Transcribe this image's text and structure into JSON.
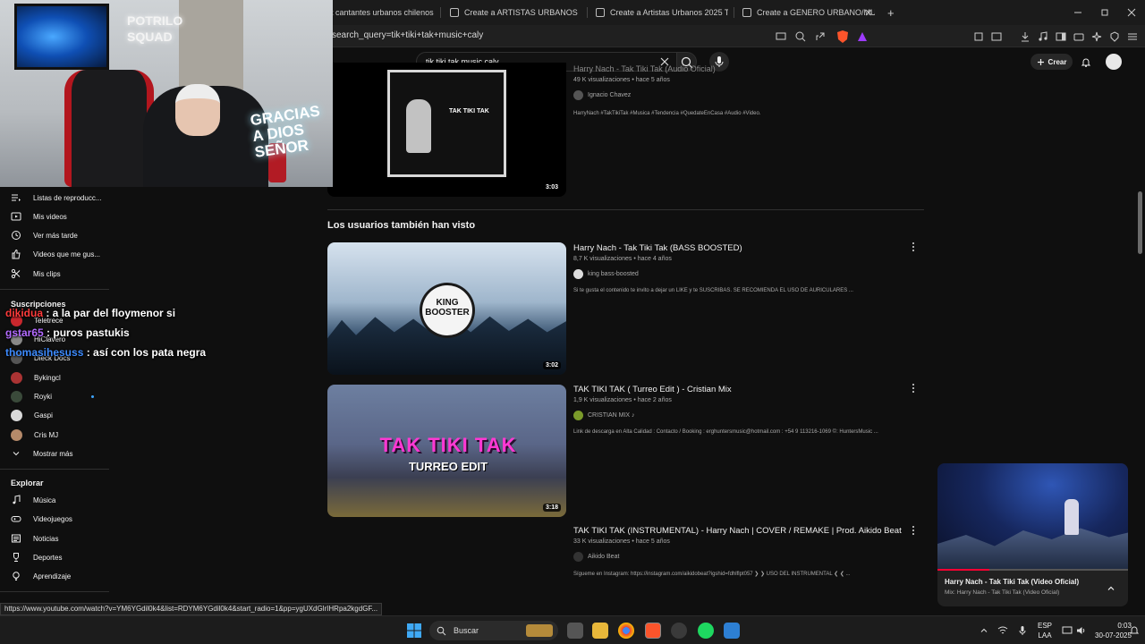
{
  "browser": {
    "tabs": [
      {
        "label": "t cantantes urbanos chilenos 20"
      },
      {
        "label": "Create a ARTISTAS URBANOS CHILE T"
      },
      {
        "label": "Create a Artistas Urbanos 2025 Tier L"
      },
      {
        "label": "Create a GENERO URBANO/MUSICO"
      }
    ],
    "new_tab_label": "+",
    "url": "search_query=tik+tiki+tak+music+caly",
    "status_url": "https://www.youtube.com/watch?v=YM6YGdil0k4&list=RDYM6YGdil0k4&start_radio=1&pp=ygUXdGlrIHRpa2kgdGF..."
  },
  "webcam": {
    "neon_sign": "POTRILO SQUAD",
    "neon_gracias": "GRACIAS A DIOS SEÑOR"
  },
  "sidebar": {
    "items": [
      {
        "label": "Listas de reproducc...",
        "icon": "playlist-icon"
      },
      {
        "label": "Mis videos",
        "icon": "video-icon"
      },
      {
        "label": "Ver más tarde",
        "icon": "clock-icon"
      },
      {
        "label": "Videos que me gus...",
        "icon": "thumbs-up-icon"
      },
      {
        "label": "Mis clips",
        "icon": "scissors-icon"
      }
    ],
    "subs_heading": "Suscripciones",
    "subs": [
      {
        "label": "Teletrece"
      },
      {
        "label": "HiClavero"
      },
      {
        "label": "Dieck Docs"
      },
      {
        "label": "Bykingcl"
      },
      {
        "label": "Royki"
      },
      {
        "label": "Gaspi"
      },
      {
        "label": "Cris MJ"
      }
    ],
    "show_more": "Mostrar más",
    "explore_heading": "Explorar",
    "explore": [
      {
        "label": "Música",
        "icon": "music-icon"
      },
      {
        "label": "Videojuegos",
        "icon": "gamepad-icon"
      },
      {
        "label": "Noticias",
        "icon": "news-icon"
      },
      {
        "label": "Deportes",
        "icon": "trophy-icon"
      },
      {
        "label": "Aprendizaje",
        "icon": "bulb-icon"
      }
    ]
  },
  "chat": [
    {
      "user": "dikidua",
      "message": " : a la par del floymenor si",
      "color": "#ff3b3b"
    },
    {
      "user": "gstar65",
      "message": " : puros pastukis",
      "color": "#b36bff"
    },
    {
      "user": "thomasihesuss",
      "message": " : así con los pata negra",
      "color": "#3d8bff"
    }
  ],
  "header": {
    "search_value": "tik tiki tak music caly",
    "create_label": "Crear"
  },
  "videos": {
    "top": {
      "title": "Harry Nach - Tak Tiki Tak (Audio Oficial)",
      "meta": "49 K visualizaciones • hace 5 años",
      "channel": "Ignacio Chavez",
      "desc": "HarryNach #TakTikiTak #Musica #Tendencia #QuedateEnCasa #Audio #Video.",
      "duration": "3:03",
      "thumb_text": "TAK TIKI TAK"
    },
    "section_title": "Los usuarios también han visto",
    "list": [
      {
        "title": "Harry Nach - Tak Tiki Tak (BASS BOOSTED)",
        "meta": "8,7 K visualizaciones • hace 4 años",
        "channel": "king bass-boosted",
        "desc": "Si te gusta el contenido te invito a dejar un LIKE y te SUSCRIBAS. SE RECOMIENDA EL USO DE AURICULARES ...",
        "duration": "3:02",
        "thumb_text": "KING BOOSTER"
      },
      {
        "title": "TAK TIKI TAK ( Turreo Edit ) - Cristian Mix",
        "meta": "1,9 K visualizaciones • hace 2 años",
        "channel": "CRISTIAN MIX ♪",
        "desc": "Link de descarga en Alta Calidad : Contacto / Booking : erghuntersmusic@hotmail.com : +54 9 113216-1069 ©: HuntersMusic ...",
        "duration": "3:18",
        "thumb_text": "TAK TIKI TAK",
        "thumb_sub": "TURREO EDIT"
      },
      {
        "title": "TAK TIKI TAK (INSTRUMENTAL) - Harry Nach | COVER / REMAKE | Prod. Aikido Beat",
        "meta": "33 K visualizaciones • hace 5 años",
        "channel": "Aikido Beat",
        "desc": "Sígueme en Instagram: https://instagram.com/aikidobeat?igshid=fdhlflpt057 ❯ ❯ USO DEL INSTRUMENTAL ❮ ❮ ..."
      }
    ]
  },
  "miniplayer": {
    "title": "Harry Nach - Tak Tiki Tak (Video Oficial)",
    "subtitle": "Mix: Harry Nach - Tak Tiki Tak (Video Oficial)",
    "progress": 0.27
  },
  "taskbar": {
    "search_label": "Buscar",
    "lang_top": "ESP",
    "lang_bottom": "LAA",
    "time": "0:03",
    "date": "30-07-2025"
  },
  "colors": {
    "background": "#0f0f0f",
    "accent_red": "#ff0033",
    "link_blue": "#3ea6ff"
  }
}
